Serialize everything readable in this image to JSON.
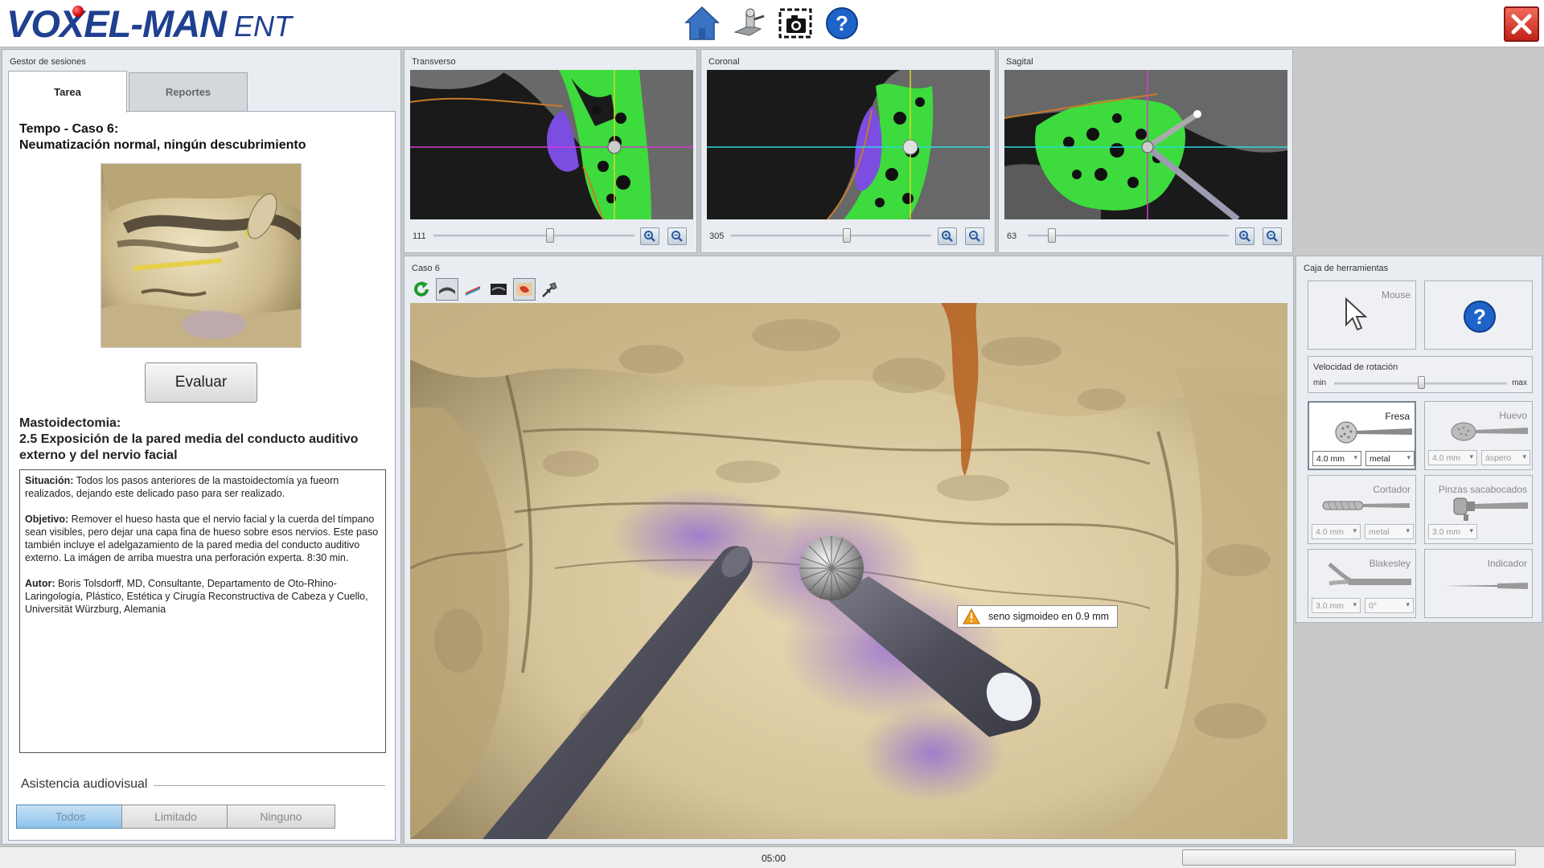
{
  "app": {
    "brand": "VOXEL-MAN",
    "suffix": "ENT",
    "top_icons": [
      "home-icon",
      "settings-icon",
      "screenshot-icon",
      "help-icon"
    ],
    "close_icon": "close-icon"
  },
  "session": {
    "title": "Gestor de sesiones",
    "tabs": [
      {
        "label": "Tarea",
        "active": true
      },
      {
        "label": "Reportes",
        "active": false
      }
    ],
    "case_title_line1": "Tempo - Caso 6:",
    "case_title_line2": "Neumatización normal, ningún descubrimiento",
    "evaluate_label": "Evaluar",
    "procedure_line1": "Mastoidectomia:",
    "procedure_line2": "2.5 Exposición de la pared media del conducto auditivo externo y del nervio facial",
    "description": {
      "situation_label": "Situación:",
      "situation_text": " Todos los pasos anteriores de la mastoidectomía ya fueorn realizados, dejando este delicado paso para ser realizado.",
      "objective_label": "Objetivo:",
      "objective_text": " Remover el hueso hasta que el nervio facial y la cuerda del tímpano sean visibles, pero dejar una capa fina de hueso sobre esos nervios. Este paso también incluye el adelgazamiento de la pared media del conducto auditivo externo. La imágen de arriba muestra una perforación experta. 8:30 min.",
      "author_label": "Autor:",
      "author_text": " Boris Tolsdorff, MD, Consultante, Departamento de Oto-Rhino-Laringología, Plástico, Estética y Cirugía Reconstructiva de Cabeza y Cuello, Universität Würzburg, Alemania"
    },
    "av_label": "Asistencia audiovisual",
    "av_options": [
      {
        "label": "Todos",
        "active": true
      },
      {
        "label": "Limitado",
        "active": false
      },
      {
        "label": "Ninguno",
        "active": false
      }
    ]
  },
  "slices": [
    {
      "title": "Transverso",
      "value": "111",
      "slider_fraction": 0.58
    },
    {
      "title": "Coronal",
      "value": "305",
      "slider_fraction": 0.58
    },
    {
      "title": "Sagital",
      "value": "63",
      "slider_fraction": 0.12
    }
  ],
  "view3d": {
    "title": "Caso 6",
    "toolbar_icons": [
      "reset-view-icon",
      "surface-mode-icon",
      "probe-icon",
      "dark-render-icon",
      "anatomy-color-icon",
      "tool-settings-icon"
    ],
    "warning_text": "seno sigmoideo en 0.9 mm"
  },
  "toolbox": {
    "title": "Caja de herramientas",
    "mouse_label": "Mouse",
    "help_icon": "help-icon",
    "rotation": {
      "label": "Velocidad de rotación",
      "min": "min",
      "max": "max",
      "fraction": 0.5
    },
    "tools": [
      {
        "name": "Fresa",
        "selected": true,
        "size": "4.0 mm",
        "type": "metal"
      },
      {
        "name": "Huevo",
        "selected": false,
        "size": "4.0 mm",
        "type": "áspero"
      },
      {
        "name": "Cortador",
        "selected": false,
        "size": "4.0 mm",
        "type": "metal"
      },
      {
        "name": "Pinzas sacabocados",
        "selected": false,
        "size": "3.0 mm"
      },
      {
        "name": "Blakesley",
        "selected": false,
        "size": "3.0 mm",
        "type": "0°"
      },
      {
        "name": "Indicador",
        "selected": false
      }
    ]
  },
  "status": {
    "timer": "05:00",
    "progress": 0
  }
}
